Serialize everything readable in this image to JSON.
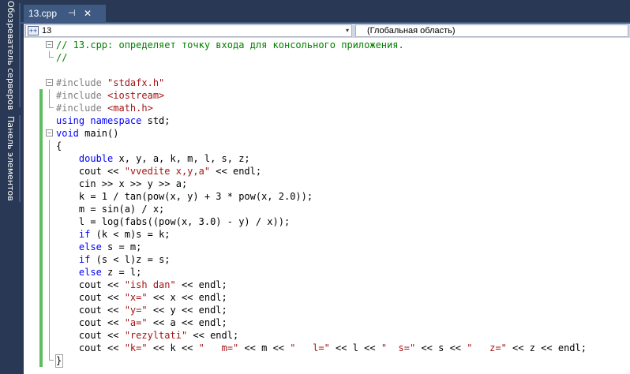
{
  "side_panels": [
    {
      "label": "Обозреватель серверов"
    },
    {
      "label": "Панель элементов"
    }
  ],
  "tab": {
    "title": "13.cpp",
    "pin_glyph": "⊣",
    "close_glyph": "✕"
  },
  "nav": {
    "scope": "13",
    "function": "(Глобальная область)",
    "arrow": "▾"
  },
  "colors": {
    "keyword": "#0000ff",
    "string": "#a31515",
    "comment": "#008000",
    "preprocessor": "#808080",
    "change_bar": "#5fbd5f"
  },
  "code_lines": [
    {
      "fold": "minus",
      "tokens": [
        {
          "c": "cm",
          "t": "// 13.cpp: определяет точку входа для консольного приложения."
        }
      ]
    },
    {
      "fold": "end",
      "tokens": [
        {
          "c": "cm",
          "t": "//"
        }
      ]
    },
    {
      "fold": "",
      "tokens": []
    },
    {
      "fold": "minus",
      "tokens": [
        {
          "c": "pp",
          "t": "#include "
        },
        {
          "c": "str",
          "t": "\"stdafx.h\""
        }
      ]
    },
    {
      "fold": "guide",
      "tokens": [
        {
          "c": "pp",
          "t": "#include "
        },
        {
          "c": "str",
          "t": "<iostream>"
        }
      ]
    },
    {
      "fold": "end",
      "tokens": [
        {
          "c": "pp",
          "t": "#include "
        },
        {
          "c": "str",
          "t": "<math.h>"
        }
      ]
    },
    {
      "fold": "",
      "tokens": [
        {
          "c": "kw",
          "t": "using namespace "
        },
        {
          "c": "plain",
          "t": "std;"
        }
      ]
    },
    {
      "fold": "minus",
      "tokens": [
        {
          "c": "kw",
          "t": "void "
        },
        {
          "c": "plain",
          "t": "main()"
        }
      ]
    },
    {
      "fold": "guide",
      "tokens": [
        {
          "c": "plain",
          "t": "{"
        }
      ]
    },
    {
      "fold": "guide",
      "tokens": [
        {
          "c": "plain",
          "t": "    "
        },
        {
          "c": "kw",
          "t": "double "
        },
        {
          "c": "plain",
          "t": "x, y, a, k, m, l, s, z;"
        }
      ]
    },
    {
      "fold": "guide",
      "tokens": [
        {
          "c": "plain",
          "t": "    cout << "
        },
        {
          "c": "str",
          "t": "\"vvedite x,y,a\""
        },
        {
          "c": "plain",
          "t": " << endl;"
        }
      ]
    },
    {
      "fold": "guide",
      "tokens": [
        {
          "c": "plain",
          "t": "    cin >> x >> y >> a;"
        }
      ]
    },
    {
      "fold": "guide",
      "tokens": [
        {
          "c": "plain",
          "t": "    k = 1 / tan(pow(x, y) + 3 * pow(x, 2.0));"
        }
      ]
    },
    {
      "fold": "guide",
      "tokens": [
        {
          "c": "plain",
          "t": "    m = sin(a) / x;"
        }
      ]
    },
    {
      "fold": "guide",
      "tokens": [
        {
          "c": "plain",
          "t": "    l = log(fabs((pow(x, 3.0) - y) / x));"
        }
      ]
    },
    {
      "fold": "guide",
      "tokens": [
        {
          "c": "plain",
          "t": "    "
        },
        {
          "c": "kw",
          "t": "if "
        },
        {
          "c": "plain",
          "t": "(k < m)s = k;"
        }
      ]
    },
    {
      "fold": "guide",
      "tokens": [
        {
          "c": "plain",
          "t": "    "
        },
        {
          "c": "kw",
          "t": "else "
        },
        {
          "c": "plain",
          "t": "s = m;"
        }
      ]
    },
    {
      "fold": "guide",
      "tokens": [
        {
          "c": "plain",
          "t": "    "
        },
        {
          "c": "kw",
          "t": "if "
        },
        {
          "c": "plain",
          "t": "(s < l)z = s;"
        }
      ]
    },
    {
      "fold": "guide",
      "tokens": [
        {
          "c": "plain",
          "t": "    "
        },
        {
          "c": "kw",
          "t": "else "
        },
        {
          "c": "plain",
          "t": "z = l;"
        }
      ]
    },
    {
      "fold": "guide",
      "tokens": [
        {
          "c": "plain",
          "t": "    cout << "
        },
        {
          "c": "str",
          "t": "\"ish dan\""
        },
        {
          "c": "plain",
          "t": " << endl;"
        }
      ]
    },
    {
      "fold": "guide",
      "tokens": [
        {
          "c": "plain",
          "t": "    cout << "
        },
        {
          "c": "str",
          "t": "\"x=\""
        },
        {
          "c": "plain",
          "t": " << x << endl;"
        }
      ]
    },
    {
      "fold": "guide",
      "tokens": [
        {
          "c": "plain",
          "t": "    cout << "
        },
        {
          "c": "str",
          "t": "\"y=\""
        },
        {
          "c": "plain",
          "t": " << y << endl;"
        }
      ]
    },
    {
      "fold": "guide",
      "tokens": [
        {
          "c": "plain",
          "t": "    cout << "
        },
        {
          "c": "str",
          "t": "\"a=\""
        },
        {
          "c": "plain",
          "t": " << a << endl;"
        }
      ]
    },
    {
      "fold": "guide",
      "tokens": [
        {
          "c": "plain",
          "t": "    cout << "
        },
        {
          "c": "str",
          "t": "\"rezyltati\""
        },
        {
          "c": "plain",
          "t": " << endl;"
        }
      ]
    },
    {
      "fold": "guide",
      "tokens": [
        {
          "c": "plain",
          "t": "    cout << "
        },
        {
          "c": "str",
          "t": "\"k=\""
        },
        {
          "c": "plain",
          "t": " << k << "
        },
        {
          "c": "str",
          "t": "\"   m=\""
        },
        {
          "c": "plain",
          "t": " << m << "
        },
        {
          "c": "str",
          "t": "\"   l=\""
        },
        {
          "c": "plain",
          "t": " << l << "
        },
        {
          "c": "str",
          "t": "\"  s=\""
        },
        {
          "c": "plain",
          "t": " << s << "
        },
        {
          "c": "str",
          "t": "\"   z=\""
        },
        {
          "c": "plain",
          "t": " << z << endl;"
        }
      ]
    },
    {
      "fold": "end",
      "tokens": [
        {
          "c": "plain",
          "t": "}"
        }
      ]
    }
  ]
}
